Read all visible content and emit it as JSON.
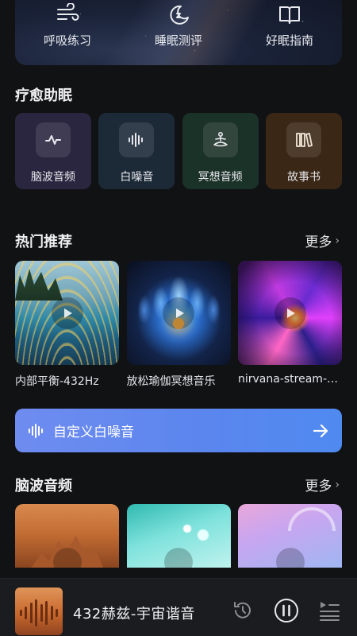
{
  "banner": {
    "items": [
      {
        "label": "呼吸练习",
        "icon": "wind-icon"
      },
      {
        "label": "睡眠测评",
        "icon": "moon-icon"
      },
      {
        "label": "好眠指南",
        "icon": "book-icon"
      }
    ]
  },
  "healing": {
    "title": "疗愈助眠",
    "tiles": [
      {
        "label": "脑波音频",
        "icon": "pulse-icon"
      },
      {
        "label": "白噪音",
        "icon": "soundwave-icon"
      },
      {
        "label": "冥想音频",
        "icon": "meditation-icon"
      },
      {
        "label": "故事书",
        "icon": "bookshelf-icon"
      }
    ]
  },
  "hot": {
    "title": "热门推荐",
    "more": "更多",
    "cards": [
      {
        "title": "内部平衡-432Hz"
      },
      {
        "title": "放松瑜伽冥想音乐"
      },
      {
        "title": "nirvana-stream-20..."
      }
    ]
  },
  "custom": {
    "label": "自定义白噪音"
  },
  "brainwave": {
    "title": "脑波音频",
    "more": "更多"
  },
  "player": {
    "title": "432赫兹-宇宙谐音"
  },
  "colors": {
    "background": "#111214",
    "accent": "#5a86ee",
    "player_bg": "#1b1c1f"
  }
}
